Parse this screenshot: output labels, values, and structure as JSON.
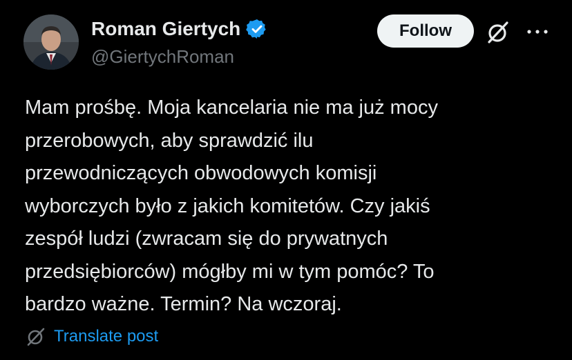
{
  "author": {
    "display_name": "Roman Giertych",
    "handle": "@GiertychRoman",
    "verified_icon": "verified-badge-icon",
    "avatar_icon": "profile-photo"
  },
  "actions": {
    "follow_label": "Follow",
    "grok_icon": "grok-icon",
    "more_icon": "more-options-icon"
  },
  "post": {
    "lines": [
      "Mam prośbę. Moja kancelaria nie ma już mocy",
      "przerobowych, aby sprawdzić ilu",
      "przewodniczących obwodowych komisji",
      "wyborczych było z jakich komitetów. Czy jakiś",
      "zespół ludzi (zwracam się do prywatnych",
      "przedsiębiorców) mógłby mi w tym pomóc? To",
      "bardzo ważne. Termin? Na wczoraj."
    ]
  },
  "translate": {
    "label": "Translate post",
    "icon": "translate-icon"
  },
  "colors": {
    "background": "#000000",
    "text_primary": "#e7e9ea",
    "text_secondary": "#71767b",
    "link_blue": "#1d9bf0",
    "follow_bg": "#eff3f4"
  }
}
